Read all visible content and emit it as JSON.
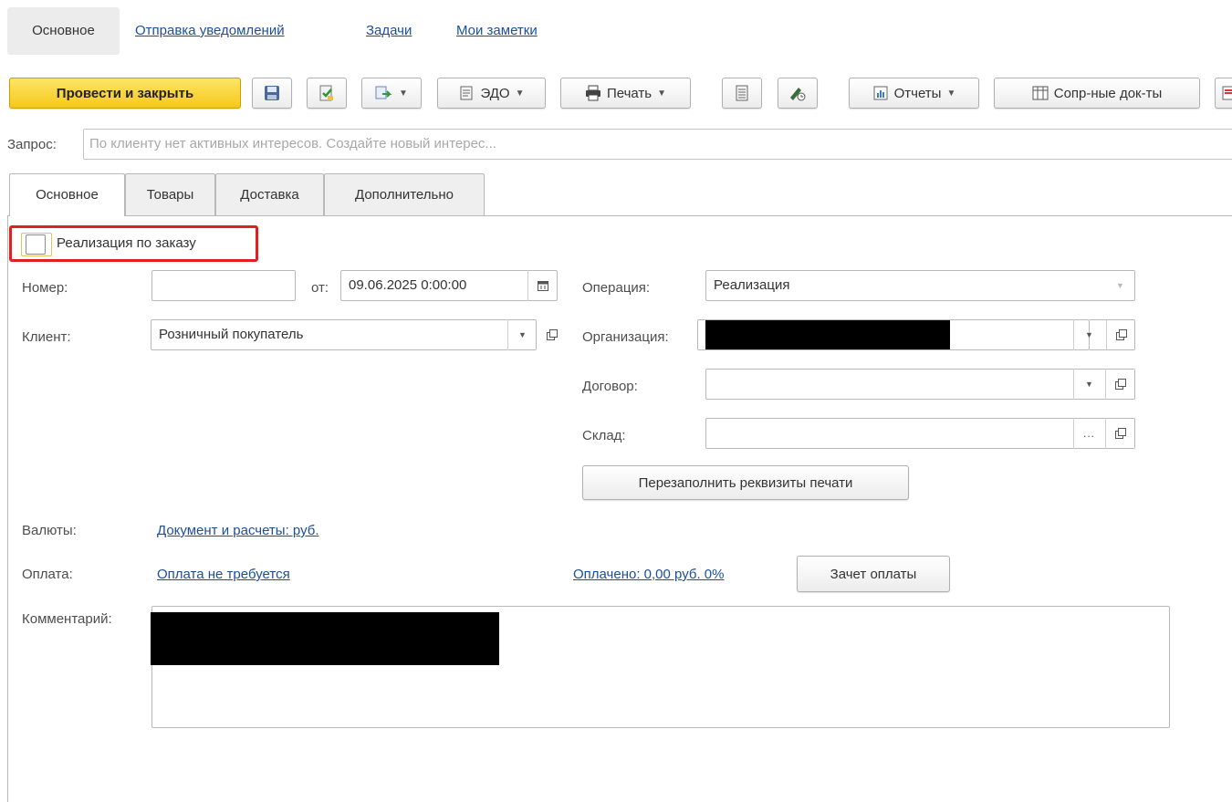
{
  "nav": {
    "active": "Основное",
    "links": [
      "Отправка уведомлений",
      "Задачи",
      "Мои заметки"
    ]
  },
  "toolbar": {
    "post_close": "Провести и закрыть",
    "edo": "ЭДО",
    "print": "Печать",
    "reports": "Отчеты",
    "related_docs": "Сопр-ные док-ты"
  },
  "request": {
    "label": "Запрос:",
    "placeholder": "По клиенту нет активных интересов. Создайте новый интерес..."
  },
  "tabs": [
    "Основное",
    "Товары",
    "Доставка",
    "Дополнительно"
  ],
  "form": {
    "by_order_label": "Реализация по заказу",
    "number_label": "Номер:",
    "number_value": "",
    "date_from_label": "от:",
    "date_value": "09.06.2025  0:00:00",
    "client_label": "Клиент:",
    "client_value": "Розничный покупатель",
    "operation_label": "Операция:",
    "operation_value": "Реализация",
    "org_label": "Организация:",
    "contract_label": "Договор:",
    "contract_value": "",
    "warehouse_label": "Склад:",
    "warehouse_value": "",
    "refill_button": "Перезаполнить реквизиты печати",
    "currency_label": "Валюты:",
    "currency_link": "Документ и расчеты: руб.",
    "payment_label": "Оплата:",
    "payment_link": "Оплата не требуется",
    "paid_link": "Оплачено: 0,00 руб. 0%",
    "offset_button": "Зачет оплаты",
    "comment_label": "Комментарий:"
  },
  "colors": {
    "primary_button": "#f6c81c",
    "link": "#1c4e9b",
    "highlight": "#e02020"
  }
}
